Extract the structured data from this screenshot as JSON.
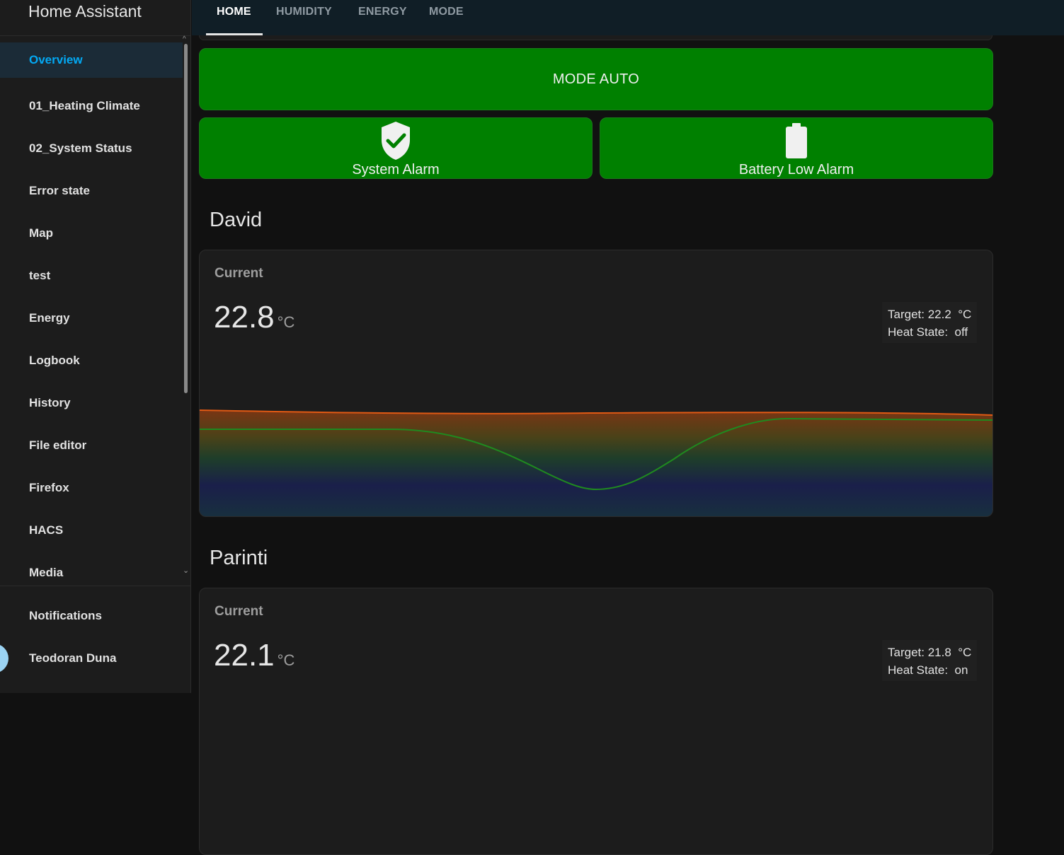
{
  "app": {
    "title": "Home Assistant"
  },
  "sidebar": {
    "items": [
      {
        "label": "Overview",
        "active": true
      },
      {
        "label": "01_Heating Climate"
      },
      {
        "label": "02_System Status"
      },
      {
        "label": "Error state"
      },
      {
        "label": "Map"
      },
      {
        "label": "test"
      },
      {
        "label": "Energy"
      },
      {
        "label": "Logbook"
      },
      {
        "label": "History"
      },
      {
        "label": "File editor"
      },
      {
        "label": "Firefox"
      },
      {
        "label": "HACS"
      },
      {
        "label": "Media"
      }
    ],
    "notifications_label": "Notifications",
    "user_name": "Teodoran Duna"
  },
  "tabs": [
    {
      "label": "HOME",
      "active": true
    },
    {
      "label": "HUMIDITY"
    },
    {
      "label": "ENERGY"
    },
    {
      "label": "MODE"
    }
  ],
  "buttons": {
    "mode_label": "MODE AUTO",
    "system_alarm_label": "System Alarm",
    "battery_alarm_label": "Battery Low Alarm",
    "accent_color": "#008000"
  },
  "rooms": [
    {
      "name": "David",
      "current_label": "Current",
      "temperature": "22.8",
      "unit": "°C",
      "target_line": "Target: 22.2  °C",
      "heat_state_line": "Heat State:  off"
    },
    {
      "name": "Parinti",
      "current_label": "Current",
      "temperature": "22.1",
      "unit": "°C",
      "target_line": "Target: 21.8  °C",
      "heat_state_line": "Heat State:  on"
    }
  ]
}
